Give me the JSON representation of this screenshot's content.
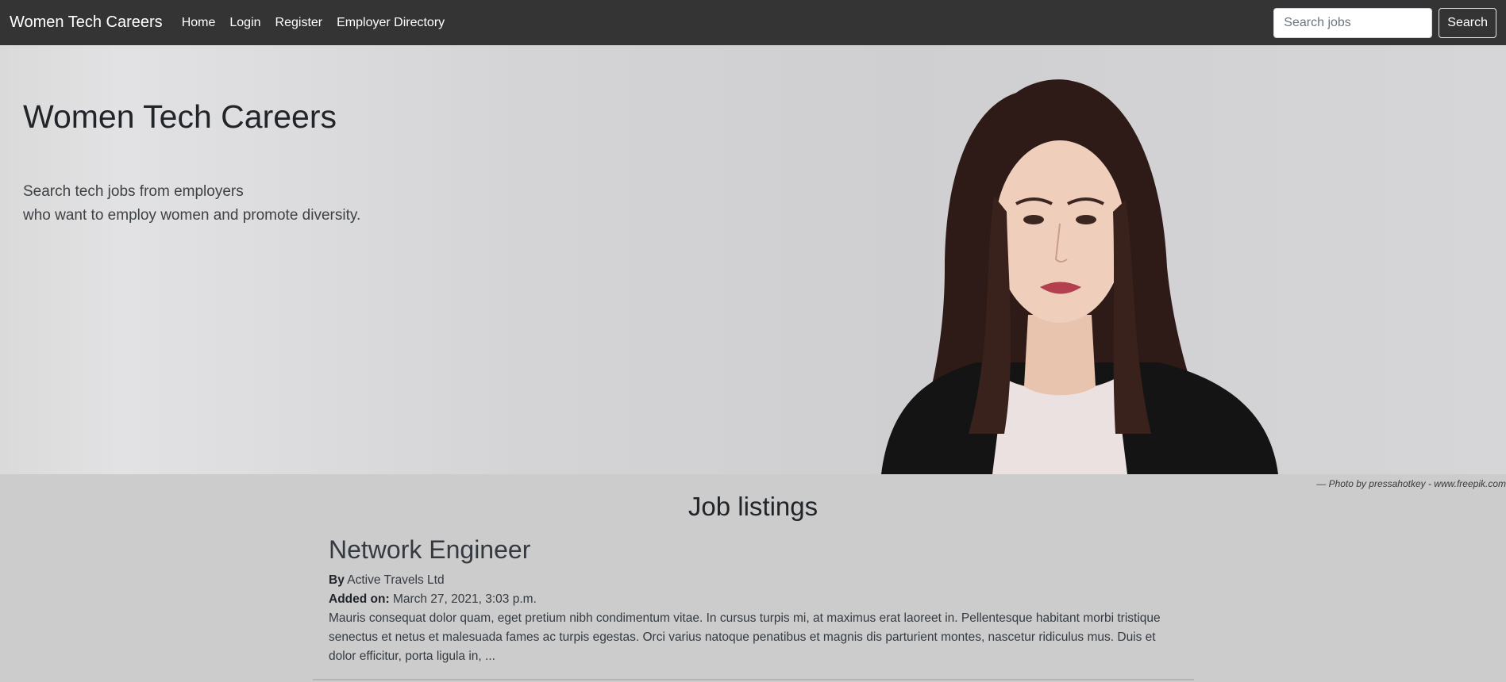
{
  "navbar": {
    "brand": "Women Tech Careers",
    "links": [
      "Home",
      "Login",
      "Register",
      "Employer Directory"
    ],
    "search_placeholder": "Search jobs",
    "search_button": "Search"
  },
  "hero": {
    "title": "Women Tech Careers",
    "subtitle_line1": "Search tech jobs from employers",
    "subtitle_line2": "who want to employ women and promote diversity.",
    "photo_credit": "— Photo by pressahotkey - www.freepik.com"
  },
  "listings": {
    "title": "Job listings",
    "jobs": [
      {
        "title": "Network Engineer",
        "by_label": "By",
        "employer": "Active Travels Ltd",
        "added_label": "Added on:",
        "added_on": "March 27, 2021, 3:03 p.m.",
        "description": "Mauris consequat dolor quam, eget pretium nibh condimentum vitae. In cursus turpis mi, at maximus erat laoreet in. Pellentesque habitant morbi tristique senectus et netus et malesuada fames ac turpis egestas. Orci varius natoque penatibus et magnis dis parturient montes, nascetur ridiculus mus. Duis et dolor efficitur, porta ligula in, ..."
      }
    ]
  },
  "colors": {
    "navbar_bg": "#343434",
    "page_bg": "#cccccc"
  }
}
